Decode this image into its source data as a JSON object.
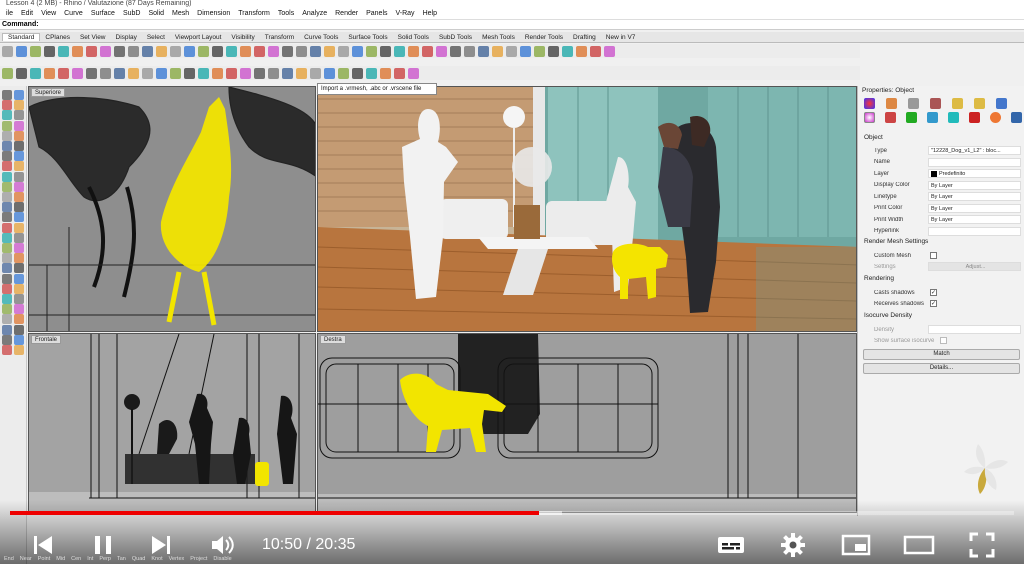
{
  "window": {
    "title": "Lesson 4 (2 MB) - Rhino / Valutazione (87 Days Remaining)"
  },
  "menu": [
    "ile",
    "Edit",
    "View",
    "Curve",
    "Surface",
    "SubD",
    "Solid",
    "Mesh",
    "Dimension",
    "Transform",
    "Tools",
    "Analyze",
    "Render",
    "Panels",
    "V-Ray",
    "Help"
  ],
  "command": {
    "label": "Command:"
  },
  "tabs": [
    "Standard",
    "CPlanes",
    "Set View",
    "Display",
    "Select",
    "Viewport Layout",
    "Visibility",
    "Transform",
    "Curve Tools",
    "Surface Tools",
    "Solid Tools",
    "SubD Tools",
    "Mesh Tools",
    "Render Tools",
    "Drafting",
    "New in V7"
  ],
  "tooltip": "Import a .vrmesh, .abc or .vrscene file",
  "viewports": {
    "top": "Superiore",
    "perspective": "",
    "front": "Frontale",
    "right": "Destra"
  },
  "properties": {
    "title": "Properties: Object",
    "section_object": "Object",
    "rows": [
      {
        "k": "Type",
        "v": "\"12228_Dog_v1_L2\" : bloc..."
      },
      {
        "k": "Name",
        "v": ""
      },
      {
        "k": "Layer",
        "v": "Predefinito"
      },
      {
        "k": "Display Color",
        "v": "By Layer"
      },
      {
        "k": "Linetype",
        "v": "By Layer"
      },
      {
        "k": "Print Color",
        "v": "By Layer"
      },
      {
        "k": "Print Width",
        "v": "By Layer"
      },
      {
        "k": "Hyperlink",
        "v": ""
      }
    ],
    "section_render_mesh": "Render Mesh Settings",
    "custom_mesh": "Custom Mesh",
    "settings": "Settings",
    "adjust": "Adjust...",
    "section_rendering": "Rendering",
    "casts_shadows": "Casts shadows",
    "receives_shadows": "Receives shadows",
    "section_isocurve": "Isocurve Density",
    "density": "Density",
    "show_isocurve": "Show surface isocurve",
    "match": "Match",
    "details": "Details..."
  },
  "player": {
    "current_time": "10:50",
    "separator": " / ",
    "total_time": "20:35",
    "played_fraction": 0.527,
    "buffered_fraction": 0.55
  },
  "statusbar": [
    "End",
    "Near",
    "Point",
    "Mid",
    "Cen",
    "Int",
    "Perp",
    "Tan",
    "Quad",
    "Knot",
    "Vertex",
    "Project",
    "Disable"
  ],
  "colors": {
    "accent": "#e00000",
    "selected": "#f2e500"
  }
}
